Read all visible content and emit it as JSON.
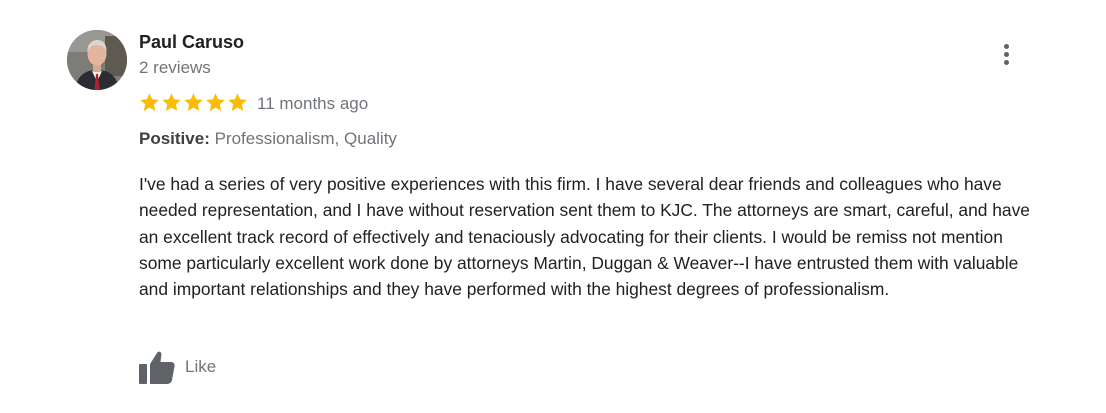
{
  "review": {
    "reviewer_name": "Paul Caruso",
    "review_count": "2 reviews",
    "rating": 5,
    "rating_max": 5,
    "date": "11 months ago",
    "attributes_label": "Positive:",
    "attributes_value": "Professionalism, Quality",
    "text": "I've had a series of very positive experiences with this firm. I have several dear friends and colleagues who have needed representation, and I have without reservation sent them to KJC. The attorneys are smart, careful, and have an excellent track record of effectively and tenaciously advocating for their clients. I would be remiss not mention some particularly excellent work done by attorneys Martin, Duggan & Weaver--I have entrusted them with valuable and important relationships and they have performed with the highest degrees of professionalism.",
    "like_label": "Like"
  },
  "icons": {
    "star": "star-icon",
    "more": "more-vert-icon",
    "like": "thumbs-up-icon"
  },
  "colors": {
    "star": "#fbbc04",
    "name": "#202124",
    "secondary_text": "#70757a",
    "icon_gray": "#5f6368"
  }
}
